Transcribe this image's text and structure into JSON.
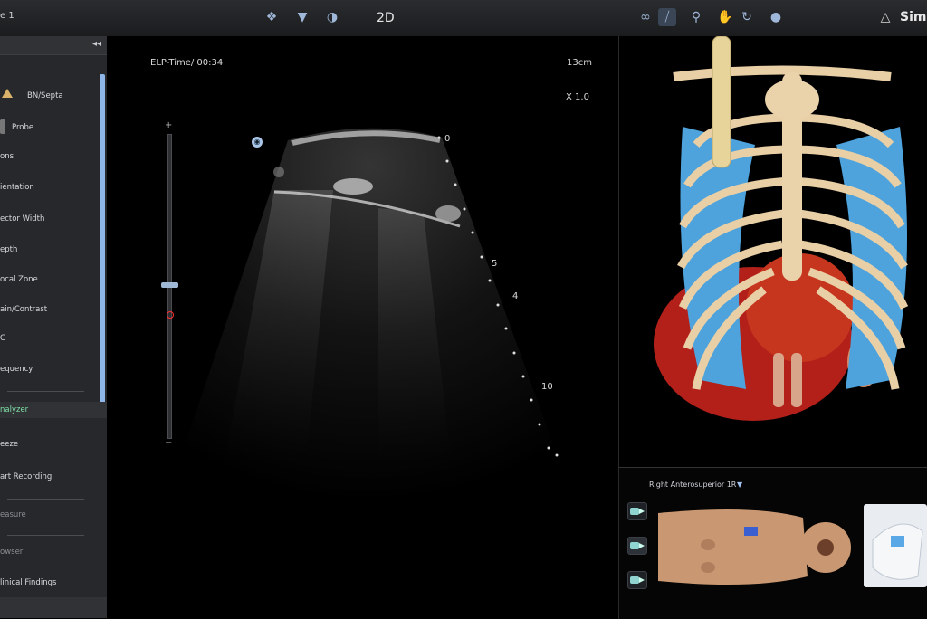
{
  "topbar": {
    "tab_label": "e 1",
    "mode_label": "2D",
    "brand_label": "Sim",
    "icons": [
      "teeth-icon",
      "probe-icon",
      "light-bulb-icon",
      "link-icon",
      "slash-probe-icon",
      "zoom-icon",
      "rotate-hand-icon",
      "refresh-icon",
      "sphere-icon",
      "app-logo-icon"
    ]
  },
  "sidebar": {
    "collapse_label": "◂◂",
    "items": [
      {
        "label": "BN/Septa"
      },
      {
        "label": "Probe"
      },
      {
        "label": "ons"
      },
      {
        "label": "ientation"
      },
      {
        "label": "ector Width"
      },
      {
        "label": "epth"
      },
      {
        "label": "ocal Zone"
      },
      {
        "label": "ain/Contrast"
      },
      {
        "label": "C"
      },
      {
        "label": "equency"
      }
    ],
    "analyzer_label": "nalyzer",
    "actions": [
      {
        "label": "eeze"
      },
      {
        "label": "art Recording"
      }
    ],
    "dim_items": [
      {
        "label": "easure"
      },
      {
        "label": "owser"
      }
    ],
    "findings_label": "linical Findings"
  },
  "ultrasound": {
    "elp_time": "ELP-Time/ 00:34",
    "depth": "13cm",
    "zoom": "X 1.0",
    "depth_markers": [
      "0",
      "5",
      "10"
    ],
    "focus_marker": "4"
  },
  "probe_panel": {
    "title": "Right Anterosuperior 1R",
    "dropdown_icon": "▼"
  },
  "colors": {
    "accent_blue": "#8fb6e8",
    "sidebar_bg": "#26282b",
    "analyzer_green": "#7fe0a8",
    "heart_red": "#b3201a",
    "rib_bone": "#e8cfa6",
    "lung_blue": "#4ea3dd"
  }
}
